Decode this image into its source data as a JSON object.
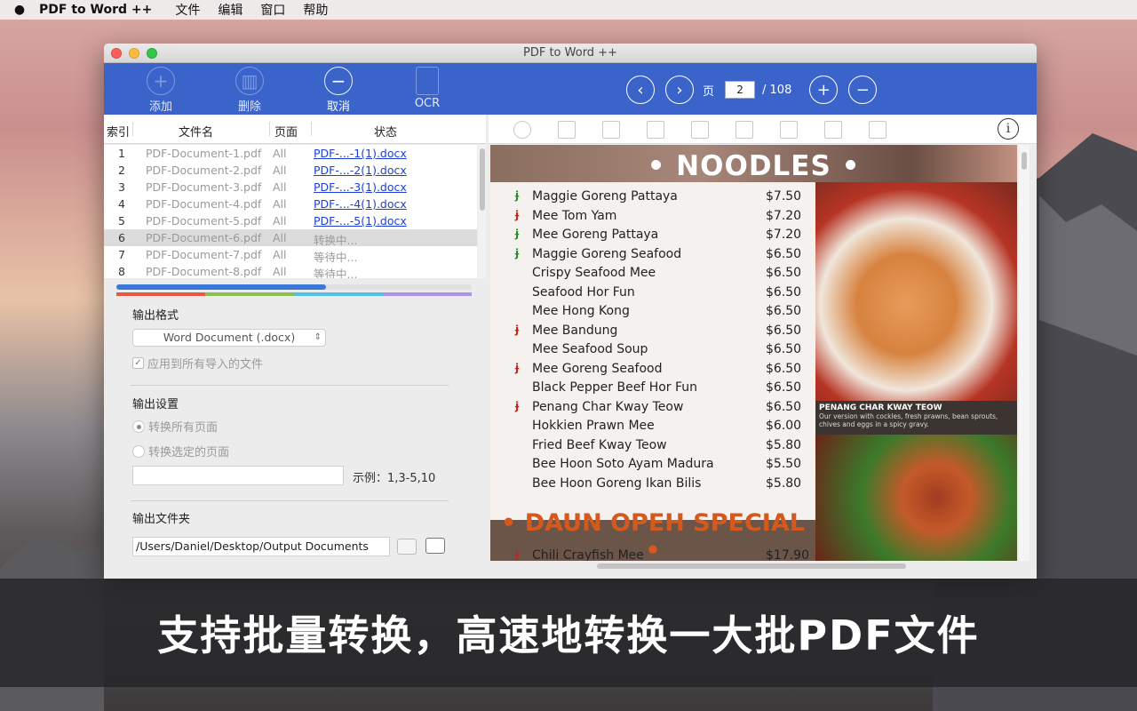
{
  "menubar": {
    "app_name": "PDF to Word ++",
    "items": [
      "文件",
      "编辑",
      "窗口",
      "帮助"
    ]
  },
  "window": {
    "title": "PDF to Word ++"
  },
  "toolbar": {
    "add_label": "添加",
    "delete_label": "删除",
    "cancel_label": "取消",
    "ocr_label": "OCR"
  },
  "nav": {
    "page_label": "页",
    "current_page": "2",
    "total_pages": "/ 108"
  },
  "table": {
    "headers": {
      "index": "索引",
      "filename": "文件名",
      "pages": "页面",
      "status": "状态"
    },
    "rows": [
      {
        "index": "1",
        "name": "PDF-Document-1.pdf",
        "pages": "All",
        "status": "PDF-...-1(1).docx",
        "link": true
      },
      {
        "index": "2",
        "name": "PDF-Document-2.pdf",
        "pages": "All",
        "status": "PDF-...-2(1).docx",
        "link": true
      },
      {
        "index": "3",
        "name": "PDF-Document-3.pdf",
        "pages": "All",
        "status": "PDF-...-3(1).docx",
        "link": true
      },
      {
        "index": "4",
        "name": "PDF-Document-4.pdf",
        "pages": "All",
        "status": "PDF-...-4(1).docx",
        "link": true
      },
      {
        "index": "5",
        "name": "PDF-Document-5.pdf",
        "pages": "All",
        "status": "PDF-...-5(1).docx",
        "link": true
      },
      {
        "index": "6",
        "name": "PDF-Document-6.pdf",
        "pages": "All",
        "status": "转换中...",
        "link": false
      },
      {
        "index": "7",
        "name": "PDF-Document-7.pdf",
        "pages": "All",
        "status": "等待中...",
        "link": false
      },
      {
        "index": "8",
        "name": "PDF-Document-8.pdf",
        "pages": "All",
        "status": "等待中...",
        "link": false
      }
    ]
  },
  "progress": {
    "fraction": 0.59
  },
  "rainbow_colors": [
    "#e8573f",
    "#8cc152",
    "#4fc1e9",
    "#ac92ec"
  ],
  "settings": {
    "output_format_label": "输出格式",
    "format_value": "Word Document (.docx)",
    "apply_all_label": "应用到所有导入的文件",
    "output_settings_label": "输出设置",
    "convert_all_label": "转换所有页面",
    "convert_selected_label": "转换选定的页面",
    "page_range_value": "",
    "example_label": "示例：1,3-5,10",
    "output_folder_label": "输出文件夹",
    "folder_path": "/Users/Daniel/Desktop/Output Documents"
  },
  "preview": {
    "heading": "• NOODLES •",
    "dishes": [
      {
        "name": "Maggie Goreng Pattaya",
        "price": "$7.50",
        "pepper": "g"
      },
      {
        "name": "Mee Tom Yam",
        "price": "$7.20",
        "pepper": "r"
      },
      {
        "name": "Mee Goreng Pattaya",
        "price": "$7.20",
        "pepper": "g"
      },
      {
        "name": "Maggie Goreng Seafood",
        "price": "$6.50",
        "pepper": "g"
      },
      {
        "name": "Crispy Seafood Mee",
        "price": "$6.50",
        "pepper": ""
      },
      {
        "name": "Seafood Hor Fun",
        "price": "$6.50",
        "pepper": ""
      },
      {
        "name": "Mee Hong Kong",
        "price": "$6.50",
        "pepper": ""
      },
      {
        "name": "Mee Bandung",
        "price": "$6.50",
        "pepper": "r"
      },
      {
        "name": "Mee Seafood Soup",
        "price": "$6.50",
        "pepper": ""
      },
      {
        "name": "Mee Goreng Seafood",
        "price": "$6.50",
        "pepper": "r"
      },
      {
        "name": "Black Pepper Beef Hor Fun",
        "price": "$6.50",
        "pepper": ""
      },
      {
        "name": "Penang Char Kway Teow",
        "price": "$6.50",
        "pepper": "r"
      },
      {
        "name": "Hokkien Prawn Mee",
        "price": "$6.00",
        "pepper": ""
      },
      {
        "name": "Fried Beef Kway Teow",
        "price": "$5.80",
        "pepper": ""
      },
      {
        "name": "Bee Hoon Soto Ayam Madura",
        "price": "$5.50",
        "pepper": ""
      },
      {
        "name": "Bee Hoon Goreng Ikan Bilis",
        "price": "$5.80",
        "pepper": ""
      }
    ],
    "caption_title": "PENANG CHAR KWAY TEOW",
    "caption_text": "Our version with cockles, fresh prawns, bean sprouts, chives and eggs in a spicy gravy.",
    "heading2": "• DAUN OPEH SPECIAL •",
    "extra_dish": {
      "name": "Chili Crayfish Mee",
      "price": "$17.90",
      "pepper": "r"
    }
  },
  "banner": {
    "text": "支持批量转换，高速地转换一大批PDF文件"
  }
}
